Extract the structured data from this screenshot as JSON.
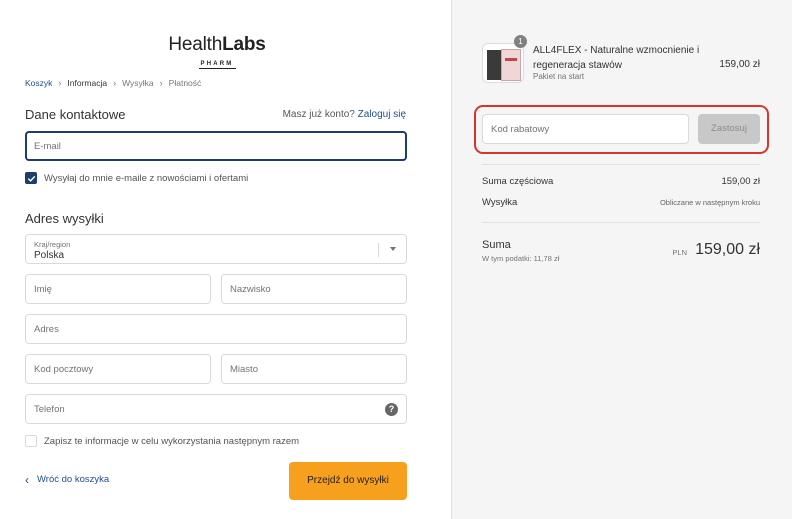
{
  "brand": {
    "name_regular": "Health",
    "name_bold": "Labs",
    "sub": "PHARM"
  },
  "breadcrumb": [
    {
      "label": "Koszyk",
      "state": "link"
    },
    {
      "label": "Informacja",
      "state": "current"
    },
    {
      "label": "Wysyłka",
      "state": "upcoming"
    },
    {
      "label": "Płatność",
      "state": "upcoming"
    }
  ],
  "breadcrumb_separator": "›",
  "contact": {
    "title": "Dane kontaktowe",
    "account_prompt": "Masz już konto?",
    "login_link": "Zaloguj się",
    "email_placeholder": "E-mail",
    "newsletter_label": "Wysyłaj do mnie e-maile z nowościami i ofertami",
    "newsletter_checked": true
  },
  "shipping": {
    "title": "Adres wysyłki",
    "country_label": "Kraj/region",
    "country_value": "Polska",
    "first_name_placeholder": "Imię",
    "last_name_placeholder": "Nazwisko",
    "address_placeholder": "Adres",
    "postal_placeholder": "Kod pocztowy",
    "city_placeholder": "Miasto",
    "phone_placeholder": "Telefon",
    "help_icon_glyph": "?",
    "save_info_label": "Zapisz te informacje w celu wykorzystania następnym razem",
    "save_info_checked": false
  },
  "actions": {
    "back_chevron": "‹",
    "back_label": "Wróć do koszyka",
    "continue_label": "Przejdź do wysyłki"
  },
  "summary": {
    "item": {
      "quantity": "1",
      "name": "ALL4FLEX - Naturalne wzmocnienie i regeneracja stawów",
      "variant": "Pakiet na start",
      "price": "159,00 zł"
    },
    "discount_placeholder": "Kod rabatowy",
    "discount_button": "Zastosuj",
    "subtotal_label": "Suma częściowa",
    "subtotal_value": "159,00 zł",
    "shipping_label": "Wysyłka",
    "shipping_value": "Obliczane w następnym kroku",
    "total_label": "Suma",
    "tax_note": "W tym podatki: 11,78 zł",
    "currency": "PLN",
    "total_value": "159,00 zł"
  },
  "colors": {
    "accent_blue": "#1d4f91",
    "focus_border": "#1d3d6b",
    "primary_button": "#f7a01e",
    "highlight_red": "#d8342c",
    "summary_bg": "#f5f5f5"
  },
  "icons": [
    "chevron-right-icon",
    "chevron-down-icon",
    "help-icon",
    "check-icon",
    "chevron-left-icon"
  ]
}
